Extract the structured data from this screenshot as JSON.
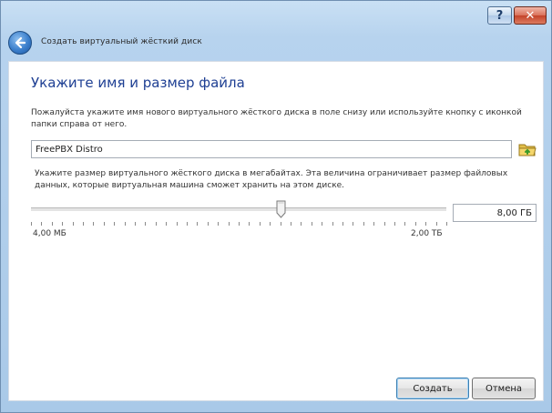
{
  "titlebar": {
    "help_label": "?",
    "close_label": "✕"
  },
  "wizard": {
    "title": "Создать виртуальный жёсткий диск"
  },
  "page": {
    "heading": "Укажите имя и размер файла",
    "name_description": "Пожалуйста укажите имя нового виртуального жёсткого диска в поле снизу или используйте кнопку с иконкой папки справа от него.",
    "name_value": "FreePBX Distro",
    "size_description": "Укажите размер виртуального жёсткого диска в мегабайтах. Эта величина ограничивает размер файловых данных, которые виртуальная машина сможет хранить на этом диске.",
    "size_value": "8,00 ГБ",
    "slider_position": 0.6,
    "range_min": "4,00 МБ",
    "range_max": "2,00 ТБ"
  },
  "footer": {
    "create_label": "Создать",
    "cancel_label": "Отмена"
  },
  "icons": {
    "back": "back-arrow-icon",
    "folder": "folder-icon"
  },
  "colors": {
    "heading": "#1e3f93",
    "frame": "#b7d3ee"
  }
}
